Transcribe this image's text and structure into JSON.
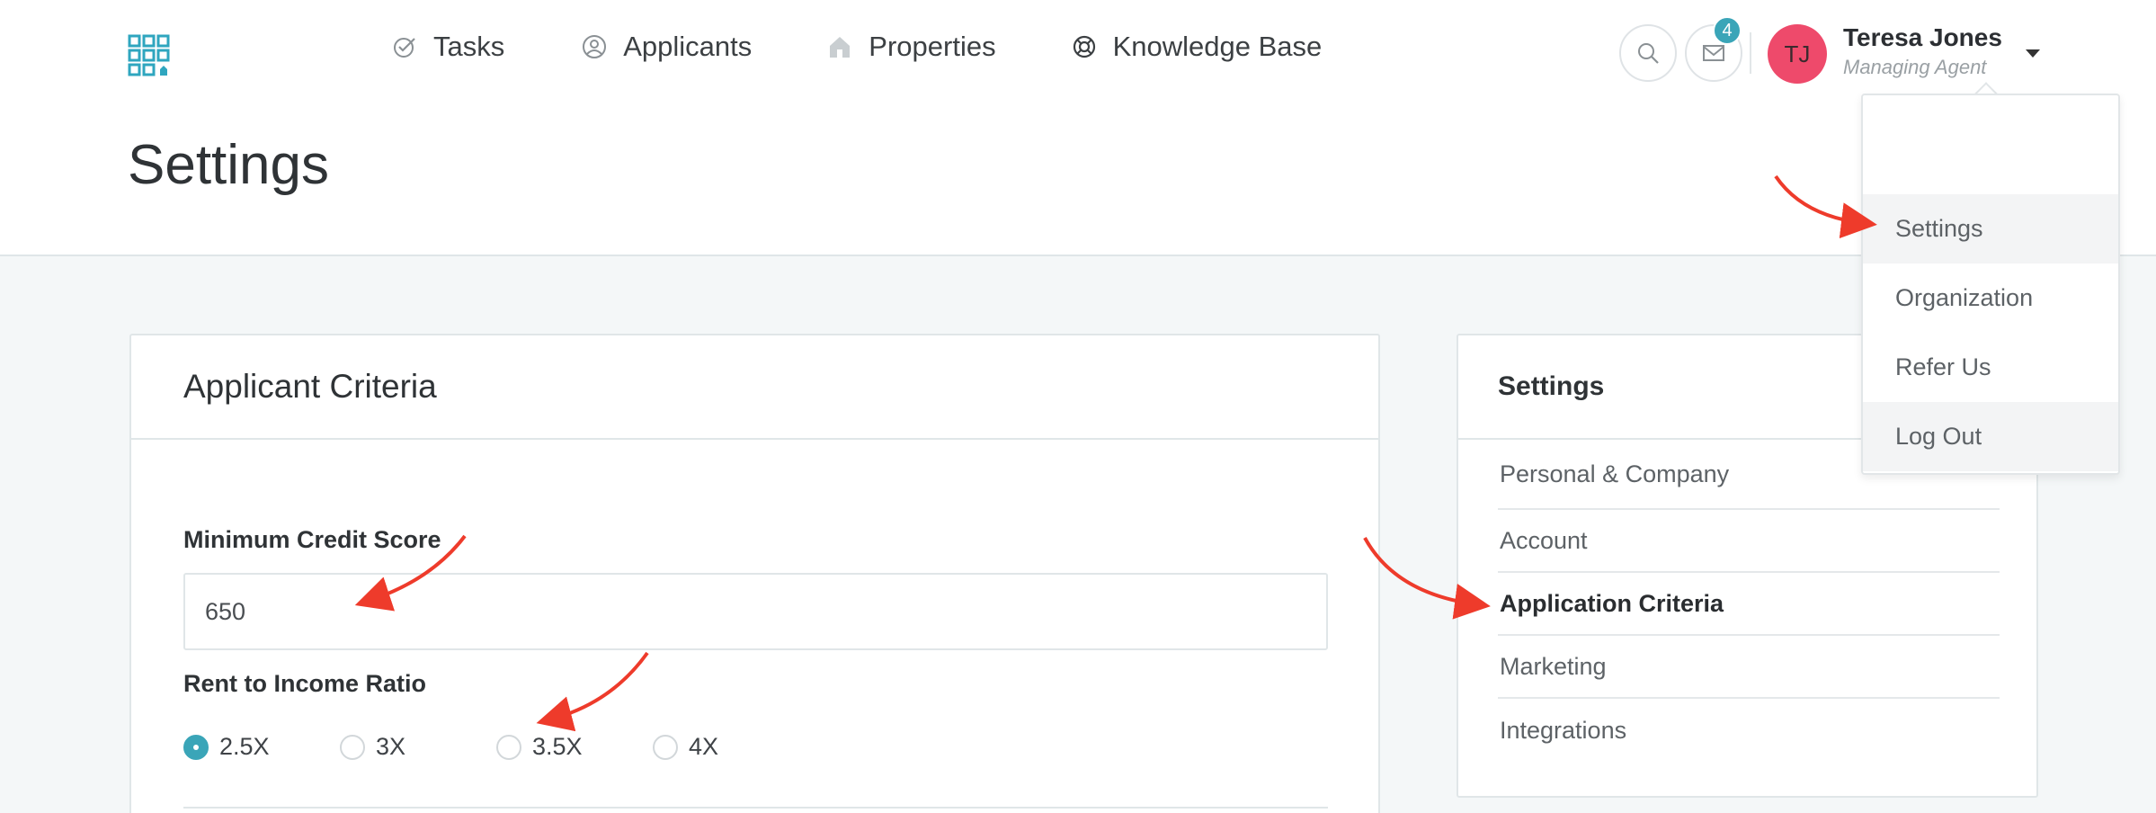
{
  "nav": {
    "items": [
      {
        "label": "Tasks",
        "icon": "check-circle-icon"
      },
      {
        "label": "Applicants",
        "icon": "user-circle-icon"
      },
      {
        "label": "Properties",
        "icon": "house-icon"
      },
      {
        "label": "Knowledge Base",
        "icon": "lifebuoy-icon"
      }
    ]
  },
  "header": {
    "notification_count": "4",
    "user": {
      "initials": "TJ",
      "name": "Teresa Jones",
      "role": "Managing Agent"
    },
    "page_title": "Settings"
  },
  "user_menu": {
    "items": [
      "Settings",
      "Organization",
      "Refer Us",
      "Log Out"
    ],
    "active": "Settings"
  },
  "criteria_card": {
    "title": "Applicant Criteria",
    "credit_label": "Minimum Credit Score",
    "credit_value": "650",
    "ratio_label": "Rent to Income Ratio",
    "ratio_options": [
      "2.5X",
      "3X",
      "3.5X",
      "4X"
    ],
    "ratio_selected": "2.5X"
  },
  "settings_nav": {
    "title": "Settings",
    "items": [
      "Personal & Company",
      "Account",
      "Application Criteria",
      "Marketing",
      "Integrations"
    ],
    "active": "Application Criteria"
  },
  "colors": {
    "accent": "#3aa5b8",
    "avatar": "#ee4a6b",
    "annotation_arrow": "#ee3b2b"
  }
}
